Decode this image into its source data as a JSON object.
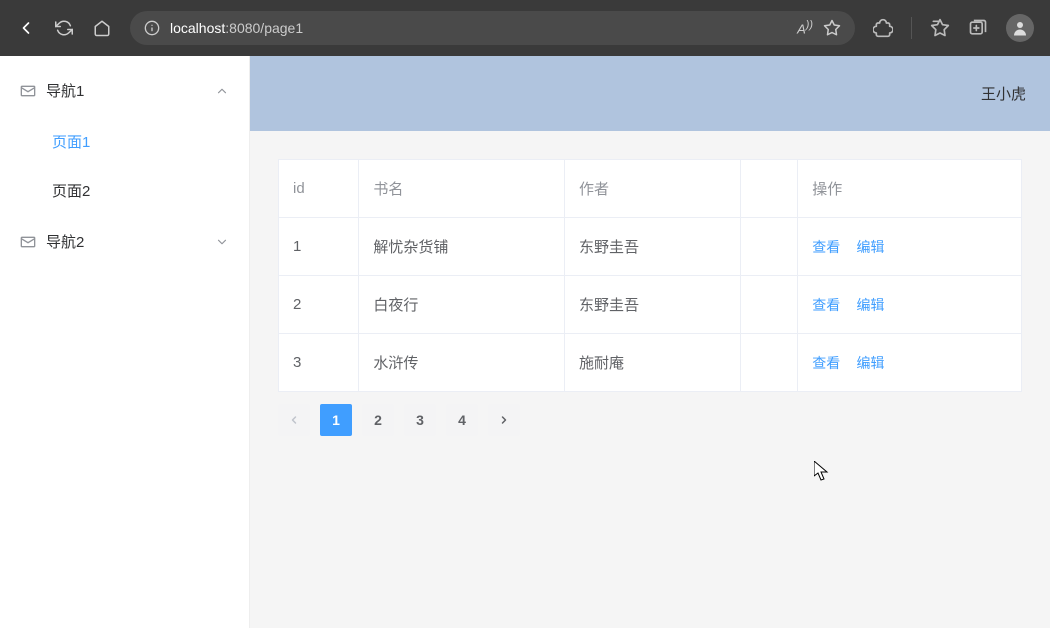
{
  "browser": {
    "url_host": "localhost",
    "url_path": ":8080/page1"
  },
  "sidebar": {
    "groups": [
      {
        "label": "导航1",
        "expanded": true,
        "items": [
          {
            "label": "页面1",
            "active": true
          },
          {
            "label": "页面2",
            "active": false
          }
        ]
      },
      {
        "label": "导航2",
        "expanded": false,
        "items": []
      }
    ]
  },
  "header": {
    "username": "王小虎"
  },
  "table": {
    "columns": [
      "id",
      "书名",
      "作者",
      "",
      "操作"
    ],
    "rows": [
      {
        "id": "1",
        "title": "解忧杂货铺",
        "author": "东野圭吾"
      },
      {
        "id": "2",
        "title": "白夜行",
        "author": "东野圭吾"
      },
      {
        "id": "3",
        "title": "水浒传",
        "author": "施耐庵"
      }
    ],
    "actions": {
      "view": "查看",
      "edit": "编辑"
    }
  },
  "pagination": {
    "pages": [
      "1",
      "2",
      "3",
      "4"
    ],
    "active": "1"
  }
}
